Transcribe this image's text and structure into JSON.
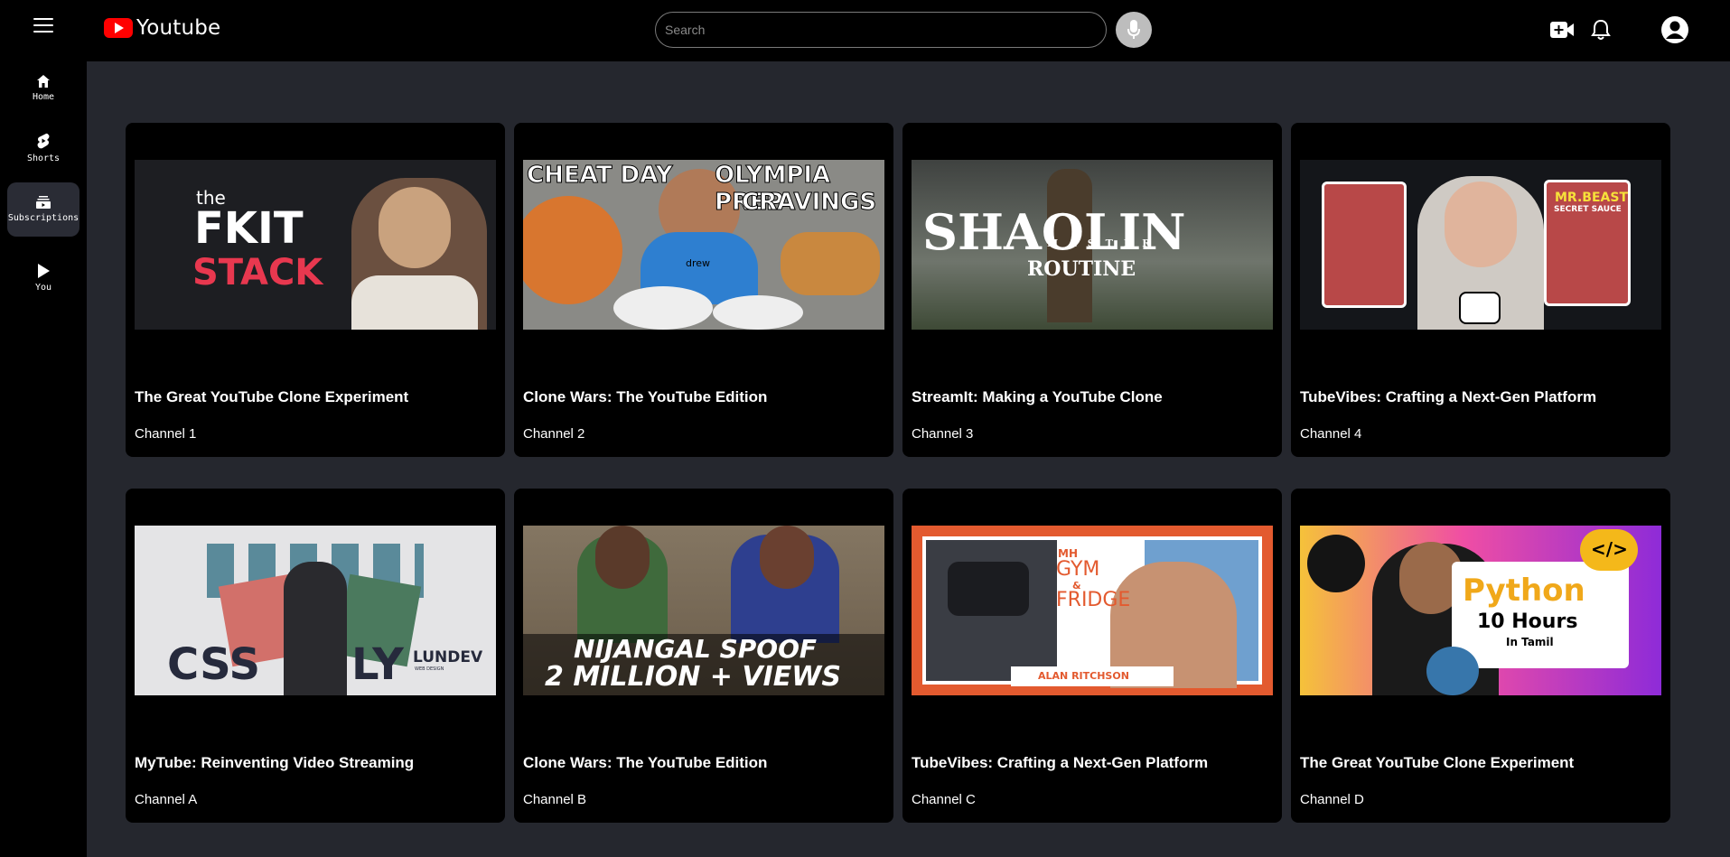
{
  "app": {
    "logo_text": "Youtube"
  },
  "search": {
    "placeholder": "Search"
  },
  "sidebar": {
    "items": [
      {
        "label": "Home",
        "icon": "home-icon"
      },
      {
        "label": "Shorts",
        "icon": "shorts-icon"
      },
      {
        "label": "Subscriptions",
        "icon": "subscriptions-icon",
        "active": true
      },
      {
        "label": "You",
        "icon": "play-icon"
      }
    ]
  },
  "thumb_text": {
    "v1": {
      "l1": "the",
      "l2": "FKIT",
      "l3": "STACK"
    },
    "v2": {
      "l1": "CHEAT DAY",
      "l2": "OLYMPIA PREP",
      "l3": "CRAVINGS",
      "shirt": "drew"
    },
    "v3": {
      "l1": "SHAOLIN",
      "l2": "MASTER",
      "l3": "ROUTINE"
    },
    "v4": {
      "l1": "MR.BEAST",
      "l2": "SECRET SAUCE"
    },
    "v5": {
      "l1": "CSS",
      "l2": "LY",
      "l3": "LUNDEV",
      "l4": "WEB DESIGN"
    },
    "v6": {
      "l1": "NIJANGAL SPOOF",
      "l2": "2 MILLION + VIEWS"
    },
    "v7": {
      "l1": "MH",
      "l2": "GYM",
      "l3": "&",
      "l4": "FRIDGE",
      "l5": "ALAN RITCHSON"
    },
    "v8": {
      "l1": "Python",
      "l2": "10 Hours",
      "l3": "In Tamil",
      "l4": "</>"
    }
  },
  "videos": [
    {
      "title": "The Great YouTube Clone Experiment",
      "channel": "Channel 1"
    },
    {
      "title": "Clone Wars: The YouTube Edition",
      "channel": "Channel 2"
    },
    {
      "title": "StreamIt: Making a YouTube Clone",
      "channel": "Channel 3"
    },
    {
      "title": "TubeVibes: Crafting a Next-Gen Platform",
      "channel": "Channel 4"
    },
    {
      "title": "MyTube: Reinventing Video Streaming",
      "channel": "Channel A"
    },
    {
      "title": "Clone Wars: The YouTube Edition",
      "channel": "Channel B"
    },
    {
      "title": "TubeVibes: Crafting a Next-Gen Platform",
      "channel": "Channel C"
    },
    {
      "title": "The Great YouTube Clone Experiment",
      "channel": "Channel D"
    }
  ],
  "colors": {
    "accent": "#ff0000",
    "background": "#25272e",
    "card": "#000000"
  }
}
